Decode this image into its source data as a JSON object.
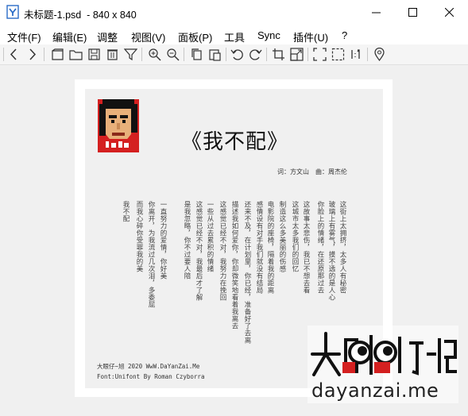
{
  "window": {
    "title": "未标题-1.psd  - 840 x 840",
    "icon": "app-icon"
  },
  "menu": [
    {
      "label": "文件(F)"
    },
    {
      "label": "编辑(E)"
    },
    {
      "label": "调整"
    },
    {
      "label": "视图(V)"
    },
    {
      "label": "面板(P)"
    },
    {
      "label": "工具"
    },
    {
      "label": "Sync"
    },
    {
      "label": "插件(U)"
    },
    {
      "label": "?"
    }
  ],
  "toolbar": [
    "back-arrow-icon",
    "forward-arrow-icon",
    "new-file-icon",
    "open-folder-icon",
    "save-icon",
    "delete-icon",
    "filter-icon",
    "zoom-in-icon",
    "zoom-out-icon",
    "copy-icon",
    "paste-icon",
    "rotate-left-icon",
    "rotate-right-icon",
    "crop-icon",
    "resize-icon",
    "fit-screen-icon",
    "selection-icon",
    "actual-size-icon",
    "location-icon"
  ],
  "document": {
    "poem_title": "《我不配》",
    "credits": "词：方文山　曲：周杰伦",
    "lyrics_columns": [
      "这街上太拥挤，太多人有秘密",
      "玻璃上有雾气，摸不透的是人心",
      "你脸上的情绪，在还原那过去",
      "这故事太悲伤，我已不想去看",
      "这城市太多我们的回忆",
      "制造这么多美丽的伤感",
      "电影院的座椅，隔着我的距离",
      "感情设有对手我们就没有结局",
      "还来不及，在计划里，你已经，准备好了去离",
      "描述我如何爱你，你却微笑地看着我离去",
      "这感觉已经不对，我努力在挽回",
      "一些从过去累积的情绪",
      "这感觉已经不对，我最后才了解",
      "是我忽略，你不过要人陪",
      "一直努力的爱情，你好美",
      "你离开，为我流过几次泪，多委屈",
      "而我心碎你受罪我的美",
      "我不配"
    ],
    "footer_line1": "大眼仔~旭 2020 WwW.DaYanZai.Me",
    "footer_line2": "Font:Unifont By Roman Czyborra"
  },
  "watermark": {
    "site": "dayanzai.me"
  },
  "colors": {
    "red": "#d42020",
    "canvas_bg": "#f0f0f0"
  }
}
